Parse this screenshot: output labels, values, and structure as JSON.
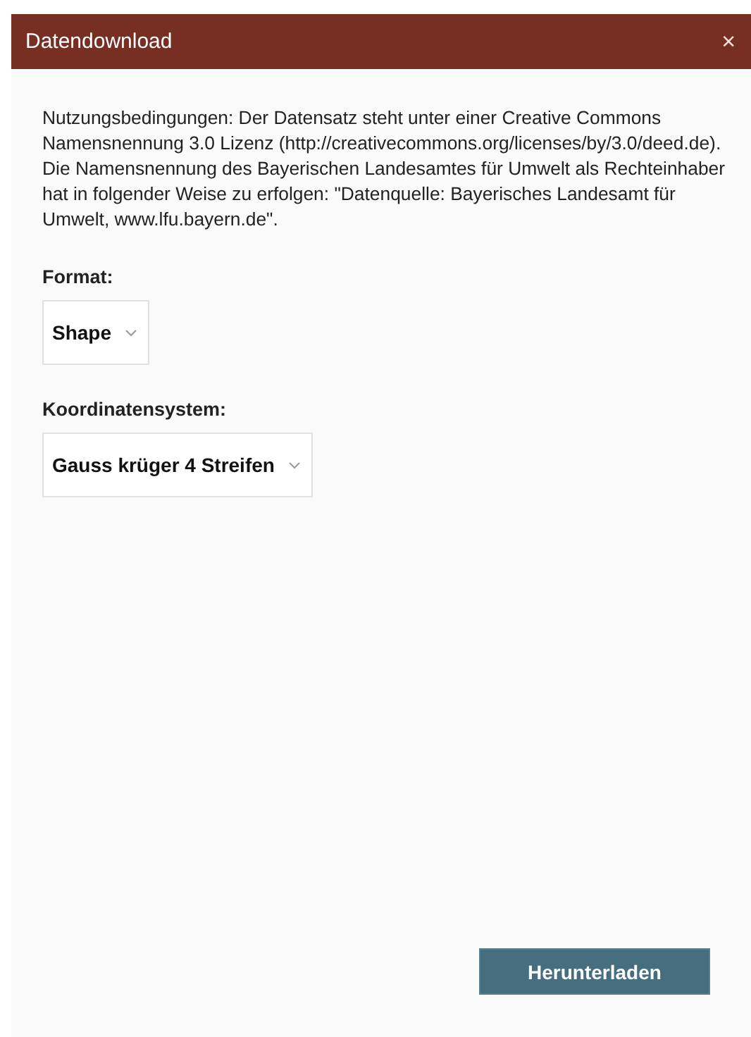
{
  "dialog": {
    "title": "Datendownload",
    "close": "×"
  },
  "terms": "Nutzungsbedingungen: Der Datensatz steht unter einer Creative Commons Namensnennung 3.0 Lizenz (http://creativecommons.org/licenses/by/3.0/deed.de). Die Namensnennung des Bayerischen Landesamtes für Umwelt als Rechteinhaber hat in folgender Weise zu erfolgen: \"Datenquelle: Bayerisches Landesamt für Umwelt, www.lfu.bayern.de\".",
  "fields": [
    {
      "label": "Format:",
      "value": "Shape"
    },
    {
      "label": "Koordinatensystem:",
      "value": "Gauss krüger 4 Streifen"
    }
  ],
  "download_button": "Herunterladen"
}
